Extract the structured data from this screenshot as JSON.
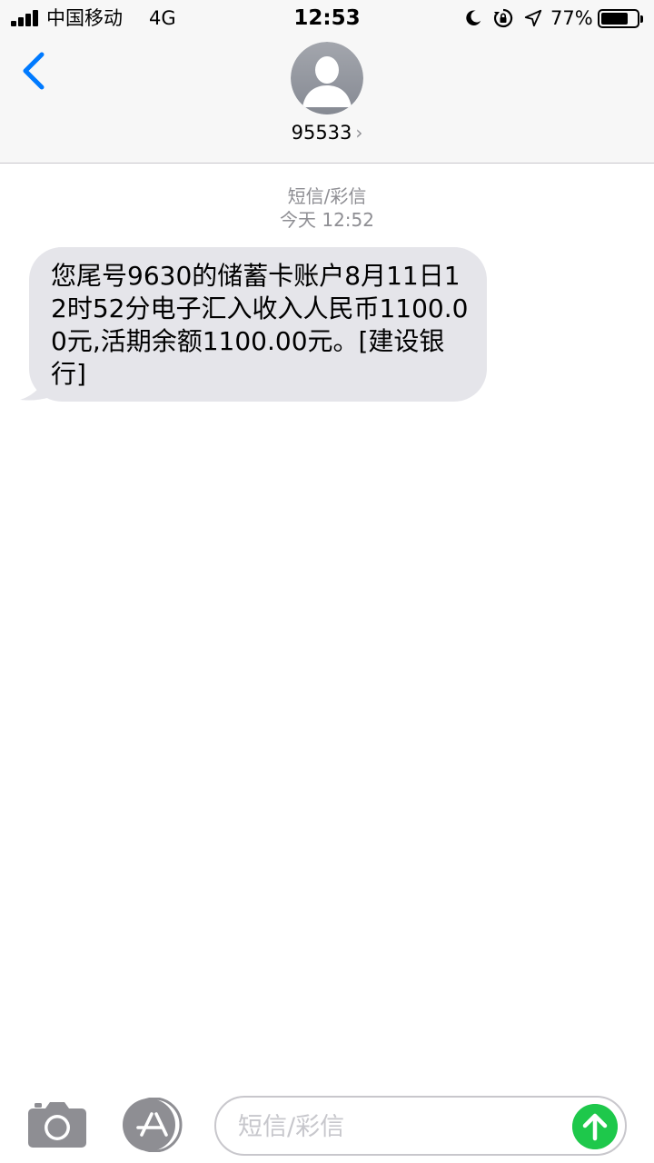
{
  "status_bar": {
    "carrier": "中国移动",
    "network": "4G",
    "time": "12:53",
    "battery_percent": "77%"
  },
  "header": {
    "contact": "95533",
    "chevron": "›",
    "icons": [
      "back-chevron-icon",
      "person-avatar-icon"
    ]
  },
  "conversation": {
    "service_label": "短信/彩信",
    "timestamp": "今天 12:52",
    "messages": [
      {
        "direction": "incoming",
        "text": "您尾号9630的储蓄卡账户8月11日12时52分电子汇入收入人民币1100.00元,活期余额1100.00元。[建设银行]"
      }
    ]
  },
  "input_bar": {
    "placeholder": "短信/彩信",
    "icons": [
      "camera-icon",
      "app-store-icon",
      "send-arrow-icon"
    ]
  },
  "colors": {
    "accent_blue": "#007aff",
    "bubble_gray": "#e5e5ea",
    "send_green": "#1ec84b",
    "meta_gray": "#8e8e93"
  }
}
